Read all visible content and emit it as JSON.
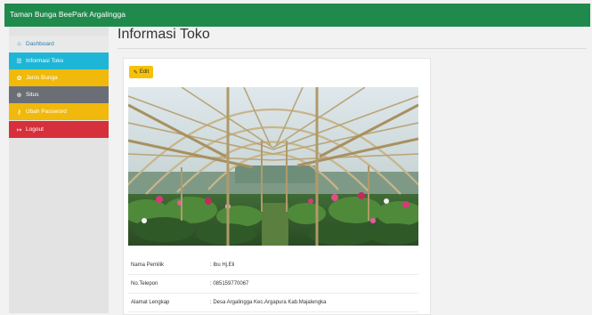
{
  "header": {
    "brand": "Taman Bunga BeePark Argalingga"
  },
  "sidebar": {
    "items": [
      {
        "label": "Dashboard",
        "icon": "home-icon"
      },
      {
        "label": "Informasi Toko",
        "icon": "list-icon"
      },
      {
        "label": "Jenis Bunga",
        "icon": "flower-icon"
      },
      {
        "label": "Situs",
        "icon": "globe-icon"
      },
      {
        "label": "Ubah Password",
        "icon": "key-icon"
      },
      {
        "label": "Logout",
        "icon": "logout-icon"
      }
    ]
  },
  "main": {
    "title": "Informasi Toko",
    "edit_label": "Edit",
    "info": [
      {
        "label": "Nama Pemilik",
        "value": ": Ibu Hj.Eli"
      },
      {
        "label": "No.Telepon",
        "value": ": 085159770067"
      },
      {
        "label": "Alamat Lengkap",
        "value": ": Desa Argalingga Kec.Argapura Kab.Majalengka"
      }
    ]
  },
  "colors": {
    "topbar": "#1f8a4c",
    "info_active": "#1eb6d6",
    "warning": "#f0b90b",
    "secondary": "#6b6f75",
    "danger": "#d6303c"
  }
}
